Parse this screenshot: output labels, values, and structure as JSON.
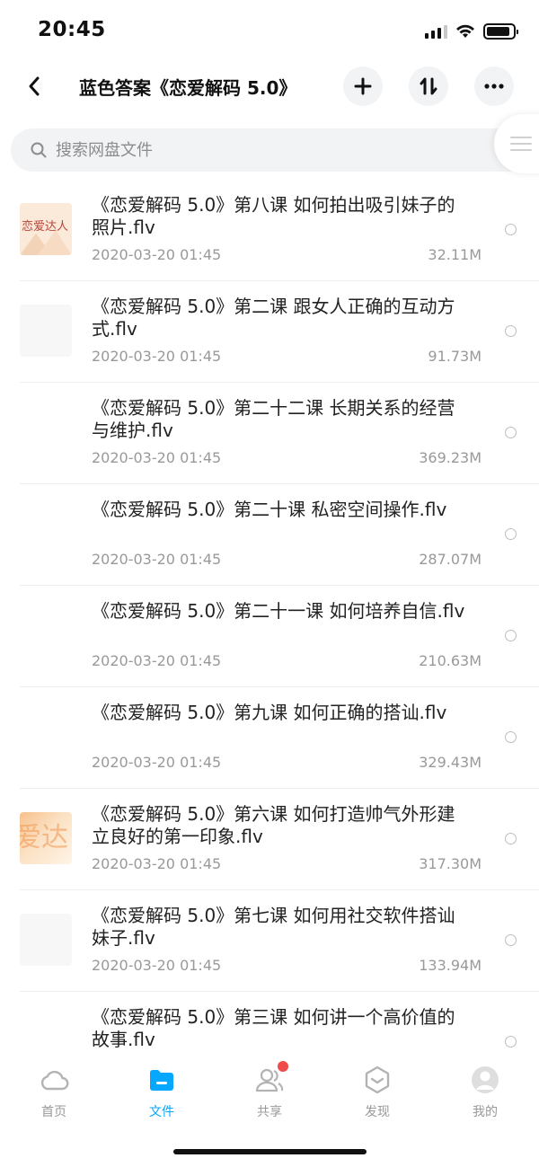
{
  "status": {
    "time": "20:45",
    "battery_level": 0.9
  },
  "nav": {
    "title": "蓝色答案《恋爱解码 5.0》",
    "back_icon": "chevron-left-icon",
    "add_icon": "plus-icon",
    "sort_icon": "sort-arrows-icon",
    "more_icon": "more-dots-icon"
  },
  "search": {
    "placeholder": "搜索网盘文件",
    "value": ""
  },
  "files": [
    {
      "name": "《恋爱解码 5.0》第八课 如何拍出吸引妹子的照片.flv",
      "date": "2020-03-20 01:45",
      "size": "32.11M",
      "thumb": "love",
      "thumb_text": "恋爱达人"
    },
    {
      "name": "《恋爱解码 5.0》第二课 跟女人正确的互动方式.flv",
      "date": "2020-03-20 01:45",
      "size": "91.73M",
      "thumb": "blank"
    },
    {
      "name": "《恋爱解码 5.0》第二十二课 长期关系的经营与维护.flv",
      "date": "2020-03-20 01:45",
      "size": "369.23M",
      "thumb": "none"
    },
    {
      "name": "《恋爱解码 5.0》第二十课 私密空间操作.flv",
      "date": "2020-03-20 01:45",
      "size": "287.07M",
      "thumb": "none"
    },
    {
      "name": "《恋爱解码 5.0》第二十一课 如何培养自信.flv",
      "date": "2020-03-20 01:45",
      "size": "210.63M",
      "thumb": "none"
    },
    {
      "name": "《恋爱解码 5.0》第九课 如何正确的搭讪.flv",
      "date": "2020-03-20 01:45",
      "size": "329.43M",
      "thumb": "none"
    },
    {
      "name": "《恋爱解码 5.0》第六课 如何打造帅气外形建立良好的第一印象.flv",
      "date": "2020-03-20 01:45",
      "size": "317.30M",
      "thumb": "orange",
      "thumb_text": "爱达"
    },
    {
      "name": "《恋爱解码 5.0》第七课 如何用社交软件搭讪妹子.flv",
      "date": "2020-03-20 01:45",
      "size": "133.94M",
      "thumb": "blank"
    },
    {
      "name": "《恋爱解码 5.0》第三课 如何讲一个高价值的故事.flv",
      "date": "",
      "size": "",
      "thumb": "none"
    }
  ],
  "tabs": [
    {
      "label": "首页",
      "icon": "cloud-icon",
      "active": false
    },
    {
      "label": "文件",
      "icon": "folder-icon",
      "active": true
    },
    {
      "label": "共享",
      "icon": "users-icon",
      "active": false,
      "badge": true
    },
    {
      "label": "发现",
      "icon": "compass-icon",
      "active": false
    },
    {
      "label": "我的",
      "icon": "avatar-icon",
      "active": false
    }
  ],
  "colors": {
    "accent": "#06a7ff",
    "badge": "#f04b4b",
    "muted_text": "#999999"
  }
}
